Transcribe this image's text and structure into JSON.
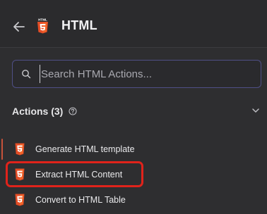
{
  "header": {
    "title": "HTML",
    "back_icon": "arrow-left-icon",
    "logo_icon": "html5-logo-icon",
    "logo_text": "HTML"
  },
  "search": {
    "placeholder": "Search HTML Actions...",
    "value": "",
    "icon": "search-icon",
    "border_color": "#4f4f86"
  },
  "section": {
    "title": "Actions (3)",
    "help_icon": "question-circle-icon",
    "chevron_icon": "chevron-down-icon"
  },
  "actions": [
    {
      "label": "Generate HTML template",
      "icon": "html5-logo-icon"
    },
    {
      "label": "Extract HTML Content",
      "icon": "html5-logo-icon",
      "highlighted": true
    },
    {
      "label": "Convert to HTML Table",
      "icon": "html5-logo-icon"
    }
  ],
  "colors": {
    "background": "#2e2e30",
    "html_orange": "#e44d26",
    "highlight_red": "#e0231b"
  }
}
